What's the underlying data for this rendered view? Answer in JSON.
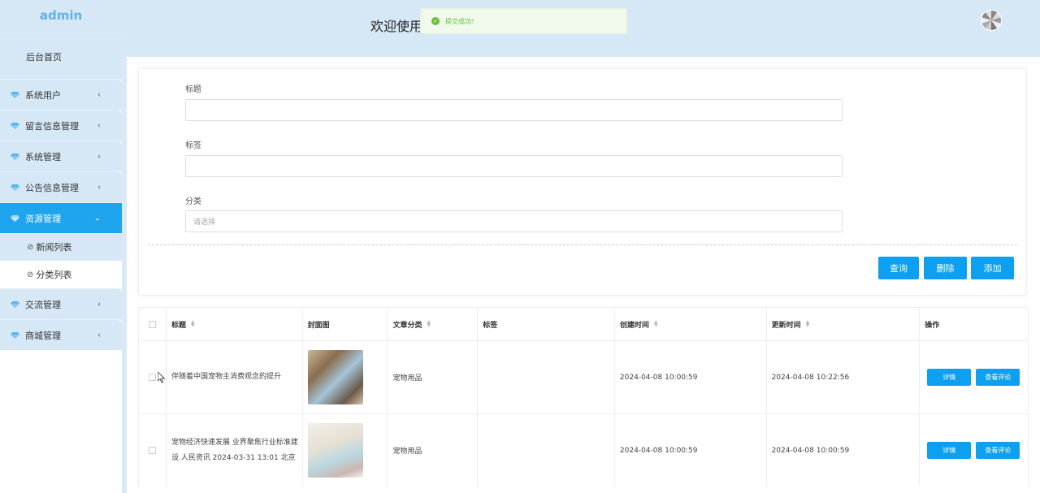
{
  "app": {
    "logo": "admin"
  },
  "header": {
    "welcome": "欢迎使用"
  },
  "toast": {
    "message": "提交成功！"
  },
  "sidebar": {
    "home": "后台首页",
    "items": [
      {
        "label": "系统用户"
      },
      {
        "label": "留言信息管理"
      },
      {
        "label": "系统管理"
      },
      {
        "label": "公告信息管理"
      },
      {
        "label": "资源管理",
        "expanded": true
      },
      {
        "label": "交流管理"
      },
      {
        "label": "商城管理"
      }
    ],
    "sub_items": [
      {
        "label": "新闻列表"
      },
      {
        "label": "分类列表"
      }
    ]
  },
  "form": {
    "title_label": "标题",
    "title_value": "",
    "tag_label": "标签",
    "tag_value": "",
    "category_label": "分类",
    "category_placeholder": "请选择",
    "buttons": {
      "query": "查询",
      "delete": "删除",
      "add": "添加"
    }
  },
  "table": {
    "columns": [
      "标题",
      "封面图",
      "文章分类",
      "标签",
      "创建时间",
      "更新时间",
      "操作"
    ],
    "rows": [
      {
        "title": "伴随着中国宠物主消费观念的提升",
        "category": "宠物用品",
        "tag": "",
        "created": "2024-04-08 10:00:59",
        "updated": "2024-04-08 10:22:56"
      },
      {
        "title": "宠物经济快速发展 业界聚焦行业标准建设 人民资讯 2024-03-31 13:01 北京",
        "category": "宠物用品",
        "tag": "",
        "created": "2024-04-08 10:00:59",
        "updated": "2024-04-08 10:00:59"
      }
    ],
    "actions": {
      "detail": "详情",
      "comments": "查看评论"
    }
  },
  "colors": {
    "primary": "#0ea0f0",
    "sidebar_bg": "#d6e8f6",
    "active_menu": "#1ea5ee",
    "success": "#67c23a"
  }
}
